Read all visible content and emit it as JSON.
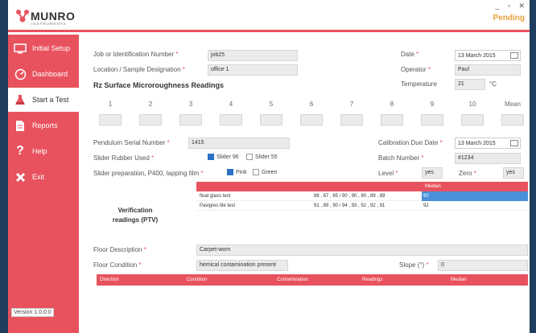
{
  "app": {
    "logo_text": "MUNRO",
    "logo_sub": "INSTRUMENTS",
    "status": "Pending",
    "win_minimize": "_",
    "win_restore": "▫",
    "win_close": "✕"
  },
  "sidebar": {
    "items": [
      {
        "label": "Initial Setup",
        "icon": "monitor-icon"
      },
      {
        "label": "Dashboard",
        "icon": "dashboard-icon"
      },
      {
        "label": "Start a Test",
        "icon": "flask-icon"
      },
      {
        "label": "Reports",
        "icon": "document-icon"
      },
      {
        "label": "Help",
        "icon": "question-icon"
      },
      {
        "label": "Exit",
        "icon": "close-icon"
      }
    ],
    "version": "Version 1.0.0.0"
  },
  "form": {
    "job_label": "Job or Identification  Number",
    "job_value": "job25",
    "location_label": "Location / Sample Designation",
    "location_value": "office 1",
    "date_label": "Date",
    "date_value": "13   March   2015",
    "operator_label": "Operator",
    "operator_value": "Paul",
    "temperature_label": "Temperature",
    "temperature_value": "21",
    "temperature_unit": "°C",
    "req": "*",
    "rz_heading": "Rz Surface Microroughness Readings",
    "rz_columns": [
      "1",
      "2",
      "3",
      "4",
      "5",
      "6",
      "7",
      "8",
      "9",
      "10",
      "Mean"
    ],
    "pendulum_label": "Pendulum Serial Number",
    "pendulum_value": "1415",
    "calib_label": "Calibration Due Date",
    "calib_value": "13   March   2015",
    "slider_label": "Slider Rubber Used",
    "slider96": "Slider 96",
    "slider55": "Slider 55",
    "batch_label": "Batch Number",
    "batch_value": "#1234",
    "prep_label": "Slider preparation, P400, lapping film",
    "pink": "Pink",
    "green": "Green",
    "level_label": "Level",
    "level_value": "yes",
    "zero_label": "Zero",
    "zero_value": "yes"
  },
  "verification": {
    "title_line1": "Verification",
    "title_line2": "readings (PTV)",
    "median_header": "Median",
    "rows": [
      {
        "name": "float glass test",
        "readings": "88 , 87 , 85 / 90 , 90 , 90 , 89 , 89",
        "median": "90"
      },
      {
        "name": "Pavigres tile test",
        "readings": "91 , 89 , 90 / 94 , 93 , 92 , 92 , 91",
        "median": "92"
      }
    ]
  },
  "floor": {
    "desc_label": "Floor Description",
    "desc_value": "Carpet-worn",
    "cond_label": "Floor Condition",
    "cond_value": "hemical contamination present",
    "slope_label": "Slope (°)",
    "slope_value": "0"
  },
  "bottom_table": {
    "headers": [
      "Direction",
      "Condition",
      "Contamination",
      "Readings",
      "Median"
    ]
  },
  "colors": {
    "accent": "#e8525e",
    "pending": "#e8a23a",
    "selection": "#4a90d9"
  }
}
